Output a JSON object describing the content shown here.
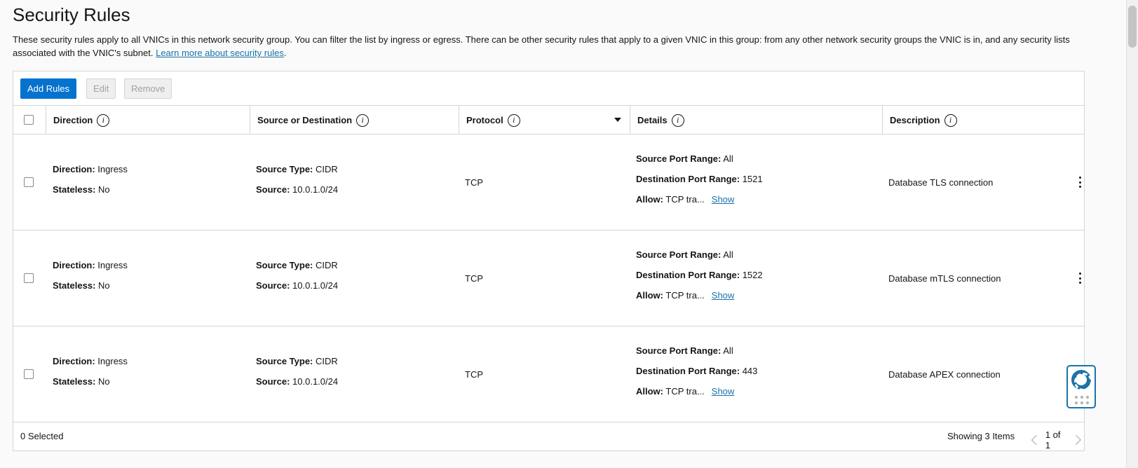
{
  "page": {
    "title": "Security Rules",
    "intro_text": "These security rules apply to all VNICs in this network security group. You can filter the list by ingress or egress. There can be other security rules that apply to a given VNIC in this group: from any other network security groups the VNIC is in, and any security lists associated with the VNIC's subnet. ",
    "learn_more_link": "Learn more about security rules",
    "intro_end": "."
  },
  "toolbar": {
    "add_label": "Add Rules",
    "edit_label": "Edit",
    "remove_label": "Remove"
  },
  "table": {
    "headers": {
      "direction": "Direction",
      "source_or_destination": "Source or Destination",
      "protocol": "Protocol",
      "details": "Details",
      "description": "Description"
    },
    "labels": {
      "direction": "Direction:",
      "stateless": "Stateless:",
      "source_type": "Source Type:",
      "source": "Source:",
      "source_port_range": "Source Port Range:",
      "destination_port_range": "Destination Port Range:",
      "allow": "Allow:",
      "show": "Show"
    },
    "rows": [
      {
        "direction": "Ingress",
        "stateless": "No",
        "source_type": "CIDR",
        "source": "10.0.1.0/24",
        "protocol": "TCP",
        "source_port_range": "All",
        "destination_port_range": "1521",
        "allow": "TCP tra...",
        "description": "Database TLS connection"
      },
      {
        "direction": "Ingress",
        "stateless": "No",
        "source_type": "CIDR",
        "source": "10.0.1.0/24",
        "protocol": "TCP",
        "source_port_range": "All",
        "destination_port_range": "1522",
        "allow": "TCP tra...",
        "description": "Database mTLS connection"
      },
      {
        "direction": "Ingress",
        "stateless": "No",
        "source_type": "CIDR",
        "source": "10.0.1.0/24",
        "protocol": "TCP",
        "source_port_range": "All",
        "destination_port_range": "443",
        "allow": "TCP tra...",
        "description": "Database APEX connection"
      }
    ]
  },
  "footer": {
    "selected": "0 Selected",
    "showing": "Showing 3 Items",
    "page": "1 of 1"
  },
  "colors": {
    "primary": "#0572ce",
    "link": "#1a73a8",
    "border": "#d6d4d2"
  },
  "icons": {
    "info": "info-icon",
    "sort": "caret-down-icon",
    "actions": "kebab-menu-icon",
    "help": "lifebuoy-icon"
  }
}
